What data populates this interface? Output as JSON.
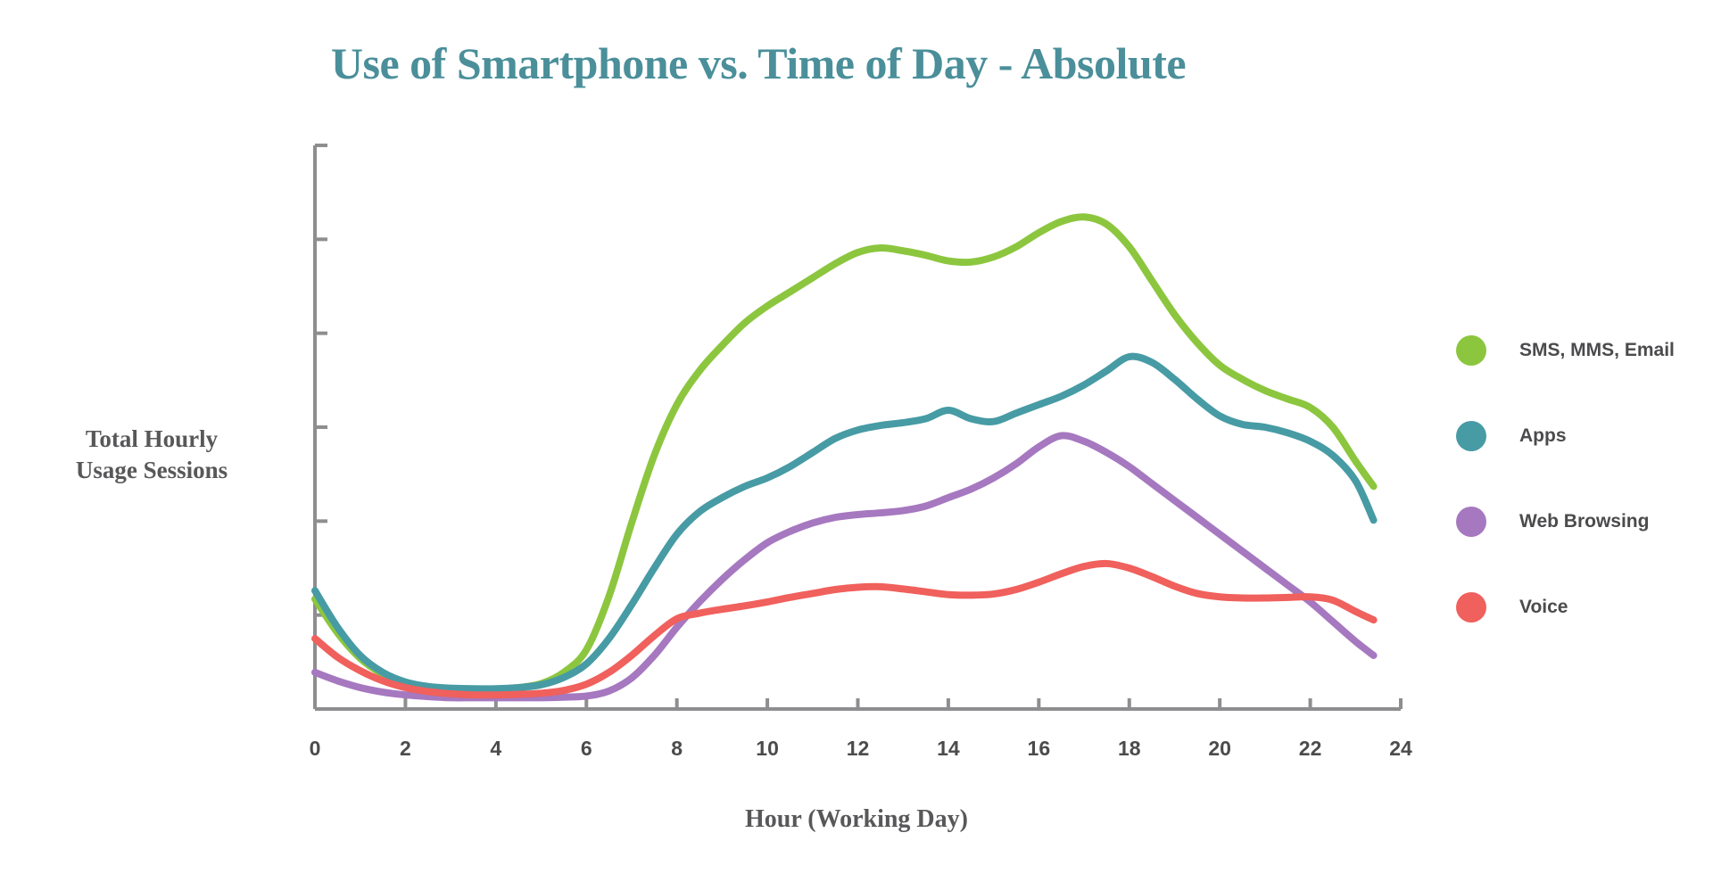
{
  "title": "Use of Smartphone vs. Time of Day - Absolute",
  "title_color": "#4a8f9a",
  "axis_color": "#8e8e90",
  "text_color": "#4b4b4d",
  "y_axis": {
    "label_line1": "Total Hourly",
    "label_line2": "Usage Sessions"
  },
  "x_axis": {
    "title": "Hour (Working Day)",
    "tick_labels": [
      "0",
      "2",
      "4",
      "6",
      "8",
      "10",
      "12",
      "14",
      "16",
      "18",
      "20",
      "22",
      "24"
    ]
  },
  "legend": {
    "items": [
      {
        "label": "SMS, MMS, Email",
        "color": "#8CC63E"
      },
      {
        "label": "Apps",
        "color": "#479BA4"
      },
      {
        "label": "Web Browsing",
        "color": "#A678C0"
      },
      {
        "label": "Voice",
        "color": "#F0605C"
      }
    ]
  },
  "chart_data": {
    "type": "line",
    "title": "Use of Smartphone vs. Time of Day - Absolute",
    "xlabel": "Hour (Working Day)",
    "ylabel": "Total Hourly Usage Sessions",
    "xlim": [
      0,
      24
    ],
    "ylim": [
      0,
      100
    ],
    "grid": false,
    "legend_position": "right",
    "y_ticks_labeled": false,
    "y_tick_count": 6,
    "x_ticks": [
      0,
      2,
      4,
      6,
      8,
      10,
      12,
      14,
      16,
      18,
      20,
      22,
      24
    ],
    "x": [
      0,
      0.5,
      1,
      1.5,
      2,
      2.5,
      3,
      3.5,
      4,
      4.5,
      5,
      5.5,
      6,
      6.5,
      7,
      7.5,
      8,
      8.5,
      9,
      9.5,
      10,
      10.5,
      11,
      11.5,
      12,
      12.5,
      13,
      13.5,
      14,
      14.5,
      15,
      15.5,
      16,
      16.5,
      17,
      17.5,
      18,
      18.5,
      19,
      19.5,
      20,
      20.5,
      21,
      21.5,
      22,
      22.5,
      23,
      23.4
    ],
    "series": [
      {
        "name": "SMS, MMS, Email",
        "color": "#8CC63E",
        "values": [
          19.5,
          13.5,
          9.0,
          6.2,
          4.6,
          3.9,
          3.6,
          3.5,
          3.5,
          3.8,
          4.5,
          6.5,
          10.5,
          20.0,
          33.0,
          45.0,
          54.0,
          60.0,
          64.5,
          68.5,
          71.5,
          74.0,
          76.5,
          79.0,
          81.0,
          81.8,
          81.3,
          80.5,
          79.5,
          79.3,
          80.2,
          82.0,
          84.5,
          86.5,
          87.3,
          86.0,
          82.0,
          76.0,
          70.0,
          65.0,
          61.0,
          58.5,
          56.5,
          55.0,
          53.5,
          50.0,
          44.0,
          39.5
        ]
      },
      {
        "name": "Apps",
        "color": "#479BA4",
        "values": [
          21.0,
          14.5,
          9.5,
          6.5,
          4.8,
          4.0,
          3.7,
          3.6,
          3.6,
          3.8,
          4.3,
          5.6,
          8.0,
          12.5,
          18.5,
          25.0,
          31.0,
          35.0,
          37.5,
          39.5,
          41.0,
          43.0,
          45.5,
          48.0,
          49.5,
          50.3,
          50.8,
          51.5,
          53.0,
          51.5,
          51.0,
          52.5,
          54.0,
          55.5,
          57.5,
          60.0,
          62.5,
          61.5,
          58.5,
          55.0,
          52.0,
          50.5,
          50.0,
          49.0,
          47.5,
          45.0,
          40.5,
          33.5
        ]
      },
      {
        "name": "Web Browsing",
        "color": "#A678C0",
        "values": [
          6.5,
          5.0,
          3.8,
          3.0,
          2.5,
          2.2,
          2.0,
          2.0,
          2.0,
          2.0,
          2.0,
          2.1,
          2.3,
          3.2,
          5.5,
          9.5,
          14.5,
          19.0,
          23.0,
          26.5,
          29.5,
          31.5,
          33.0,
          34.0,
          34.5,
          34.8,
          35.2,
          36.0,
          37.5,
          39.0,
          41.0,
          43.5,
          46.5,
          48.5,
          47.5,
          45.5,
          43.0,
          40.0,
          37.0,
          34.0,
          31.0,
          28.0,
          25.0,
          22.0,
          19.0,
          15.5,
          12.0,
          9.5
        ]
      },
      {
        "name": "Voice",
        "color": "#F0605C",
        "values": [
          12.5,
          9.2,
          6.8,
          5.0,
          3.8,
          3.1,
          2.7,
          2.5,
          2.5,
          2.6,
          2.8,
          3.3,
          4.4,
          6.5,
          9.5,
          13.0,
          16.0,
          17.0,
          17.7,
          18.3,
          19.0,
          19.8,
          20.5,
          21.2,
          21.6,
          21.7,
          21.3,
          20.8,
          20.3,
          20.2,
          20.4,
          21.2,
          22.5,
          24.0,
          25.3,
          25.8,
          25.0,
          23.5,
          21.8,
          20.5,
          19.9,
          19.7,
          19.7,
          19.8,
          19.9,
          19.3,
          17.3,
          15.8
        ]
      }
    ]
  }
}
